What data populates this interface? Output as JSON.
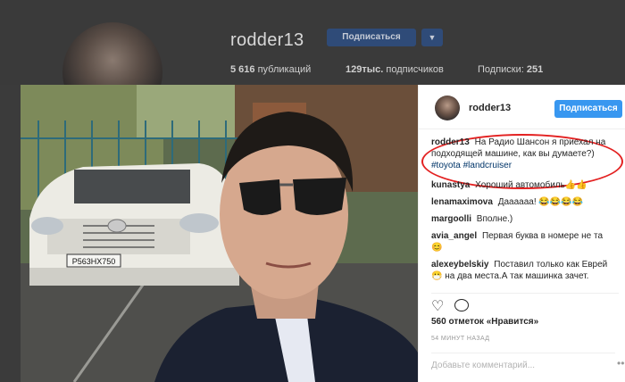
{
  "profile": {
    "username": "rodder13",
    "follow_label": "Подписаться",
    "dropdown_icon": "chevron-down-icon",
    "stats": {
      "posts": "5 616",
      "posts_label": "публикаций",
      "followers": "129тыс.",
      "followers_label": "подписчиков",
      "following_label": "Подписки:",
      "following": "251"
    }
  },
  "post": {
    "username": "rodder13",
    "follow_label": "Подписаться",
    "caption_user": "rodder13",
    "caption_text": "На Радио Шансон я приехал на подходящей машине, как вы думаете?)",
    "tags": [
      "#toyota",
      "#landcruiser"
    ],
    "plate": "Р563НХ750",
    "comments": [
      {
        "user": "kunastya",
        "text": "Хороший автомобиль👍👍"
      },
      {
        "user": "lenamaximova",
        "text": "Даааааа! 😂😂😂😂"
      },
      {
        "user": "margoolli",
        "text": "Вполне.)"
      },
      {
        "user": "avia_angel",
        "text": "Первая буква в номере не та 😊"
      },
      {
        "user": "alexeybelskiy",
        "text": "Поставил только как Еврей 😷 на два места.А так машинка зачет."
      }
    ],
    "likes": "560 отметок «Нравится»",
    "time_ago": "54 МИНУТ НАЗАД",
    "add_comment_placeholder": "Добавьте комментарий...",
    "more_icon": "more-dots-icon"
  },
  "colors": {
    "follow_blue": "#3897f0",
    "highlight_red": "#e32121",
    "hashtag": "#003569"
  }
}
